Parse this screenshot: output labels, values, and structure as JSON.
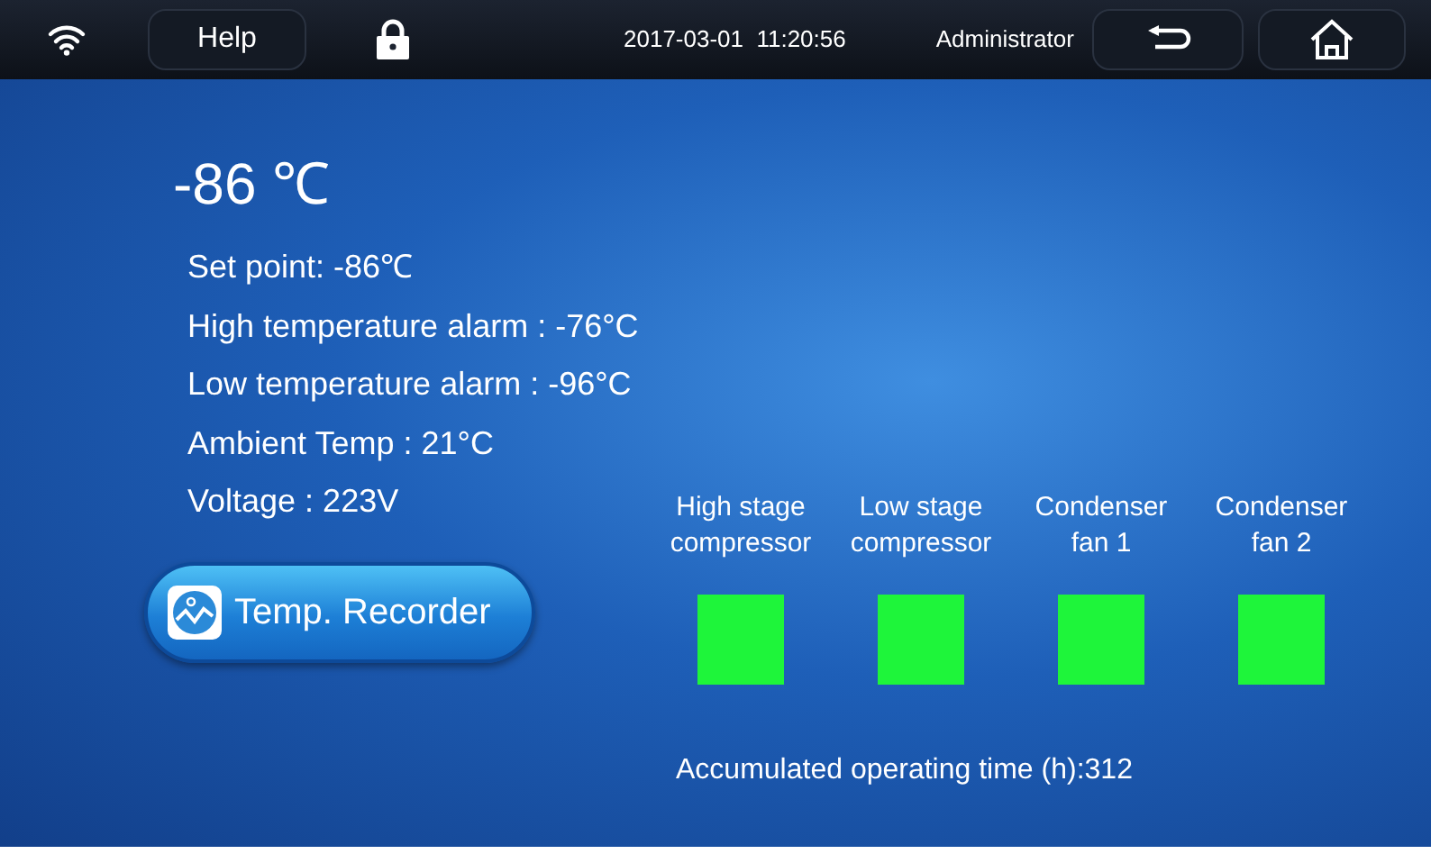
{
  "top_bar": {
    "help": "Help",
    "datetime": "2017-03-01  11:20:56",
    "user": "Administrator"
  },
  "temperature": "-86 ℃",
  "readings": [
    "Set point: -86℃",
    "High temperature alarm : -76°C",
    "Low temperature alarm : -96°C",
    "Ambient Temp : 21°C",
    "Voltage : 223V"
  ],
  "recorder_button": "Temp. Recorder",
  "components": [
    {
      "label": "High stage compressor",
      "on": true
    },
    {
      "label": "Low stage compressor",
      "on": true
    },
    {
      "label": "Condenser fan 1",
      "on": true
    },
    {
      "label": "Condenser fan 2",
      "on": true
    }
  ],
  "operating_time": "Accumulated operating time (h):312"
}
